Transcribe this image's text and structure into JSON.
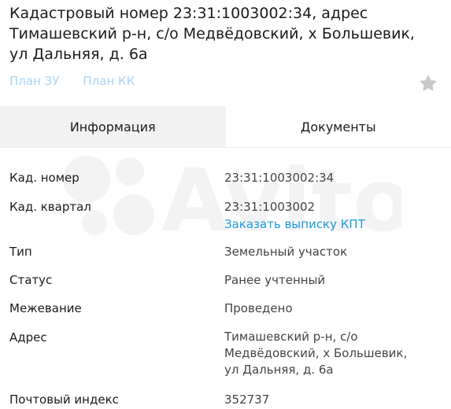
{
  "title": "Кадастровый номер 23:31:1003002:34, адрес Тимашевский р-н, с/о Медвёдовский, х Большевик, ул Дальняя, д. 6а",
  "plan_links": [
    "План ЗУ",
    "План КК"
  ],
  "tabs": [
    {
      "label": "Информация",
      "active": true
    },
    {
      "label": "Документы",
      "active": false
    }
  ],
  "details": {
    "kad_number": {
      "label": "Кад. номер",
      "value": "23:31:1003002:34"
    },
    "kad_quarter": {
      "label": "Кад. квартал",
      "value": "23:31:1003002",
      "action": "Заказать выписку КПТ"
    },
    "type": {
      "label": "Тип",
      "value": "Земельный участок"
    },
    "status": {
      "label": "Статус",
      "value": "Ранее учтенный"
    },
    "survey": {
      "label": "Межевание",
      "value": "Проведено"
    },
    "address": {
      "label": "Адрес",
      "line1": "Тимашевский р-н, с/о",
      "line2": "Медвёдовский, х Большевик,",
      "line3": "ул Дальняя, д. 6а"
    },
    "postal": {
      "label": "Почтовый индекс",
      "value": "352737"
    }
  },
  "colors": {
    "link": "#1e9be0",
    "link_faded": "#a8d4f5",
    "success": "#1da34a",
    "tab_active_bg": "#f2f2f2",
    "star": "#c8c8c8"
  },
  "icons": {
    "favorite": "star-icon"
  },
  "watermark": "Avito"
}
